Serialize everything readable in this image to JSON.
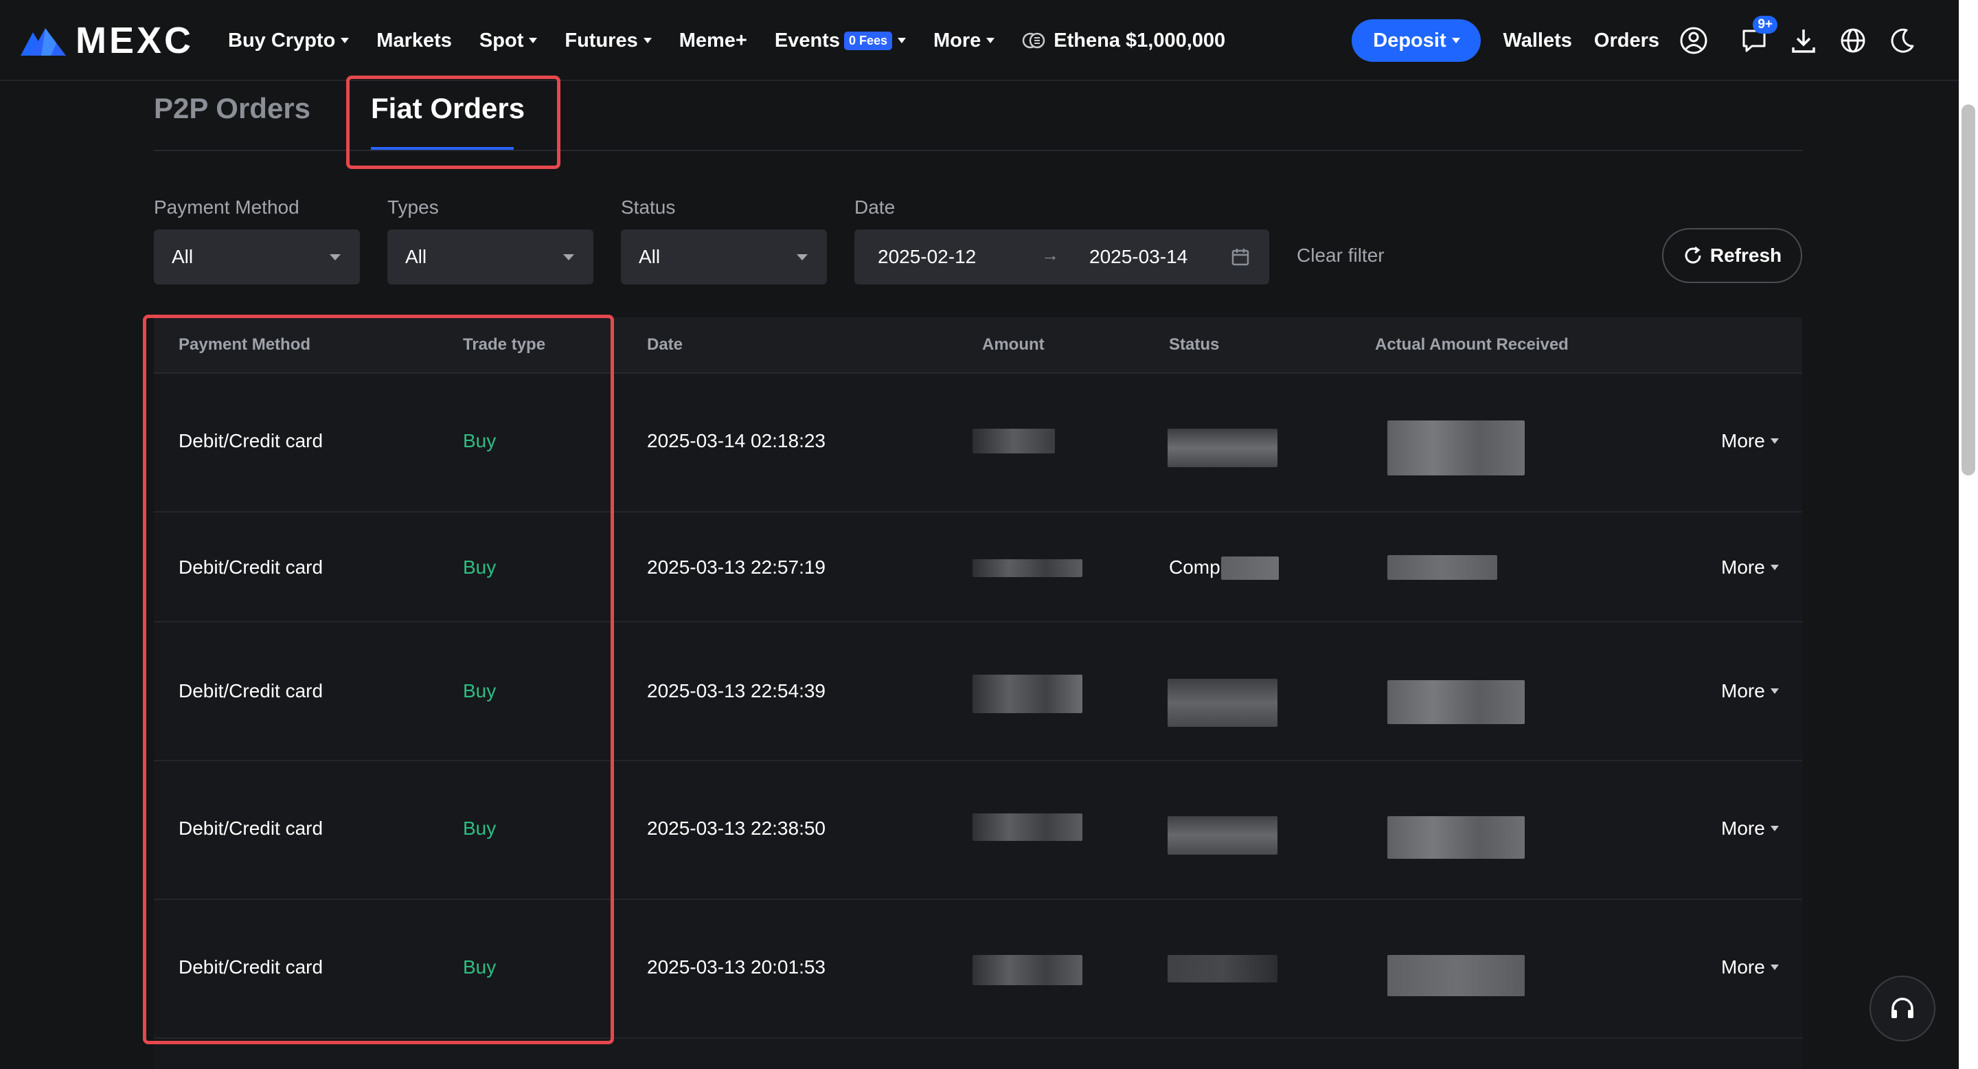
{
  "brand": {
    "name": "MEXC",
    "logo_icon": "mexc-mountain-logo"
  },
  "nav": {
    "menu": [
      {
        "label": "Buy Crypto",
        "dropdown": true
      },
      {
        "label": "Markets",
        "dropdown": false
      },
      {
        "label": "Spot",
        "dropdown": true
      },
      {
        "label": "Futures",
        "dropdown": true
      },
      {
        "label": "Meme+",
        "dropdown": false
      },
      {
        "label": "Events",
        "dropdown": true,
        "badge": "0 Fees"
      },
      {
        "label": "More",
        "dropdown": true
      }
    ],
    "promo": "Ethena $1,000,000",
    "deposit_label": "Deposit",
    "wallets_label": "Wallets",
    "orders_label": "Orders",
    "notification_badge": "9+"
  },
  "tabs": [
    {
      "label": "P2P Orders",
      "active": false
    },
    {
      "label": "Fiat Orders",
      "active": true
    }
  ],
  "filters": {
    "payment_method": {
      "label": "Payment Method",
      "value": "All"
    },
    "types": {
      "label": "Types",
      "value": "All"
    },
    "status": {
      "label": "Status",
      "value": "All"
    },
    "date": {
      "label": "Date",
      "start": "2025-02-12",
      "end": "2025-03-14"
    },
    "clear_label": "Clear filter",
    "refresh_label": "Refresh"
  },
  "table": {
    "columns": [
      "Payment Method",
      "Trade type",
      "Date",
      "Amount",
      "Status",
      "Actual Amount Received"
    ],
    "rows": [
      {
        "payment_method": "Debit/Credit card",
        "trade_type": "Buy",
        "date": "2025-03-14 02:18:23",
        "status": "",
        "more": "More"
      },
      {
        "payment_method": "Debit/Credit card",
        "trade_type": "Buy",
        "date": "2025-03-13 22:57:19",
        "status": "Comp",
        "more": "More"
      },
      {
        "payment_method": "Debit/Credit card",
        "trade_type": "Buy",
        "date": "2025-03-13 22:54:39",
        "status": "",
        "more": "More"
      },
      {
        "payment_method": "Debit/Credit card",
        "trade_type": "Buy",
        "date": "2025-03-13 22:38:50",
        "status": "",
        "more": "More"
      },
      {
        "payment_method": "Debit/Credit card",
        "trade_type": "Buy",
        "date": "2025-03-13 20:01:53",
        "status": "",
        "more": "More"
      }
    ]
  },
  "colors": {
    "background": "#141517",
    "accent": "#1f66ff",
    "buy": "#2ebd85",
    "highlight": "#e5484d"
  }
}
